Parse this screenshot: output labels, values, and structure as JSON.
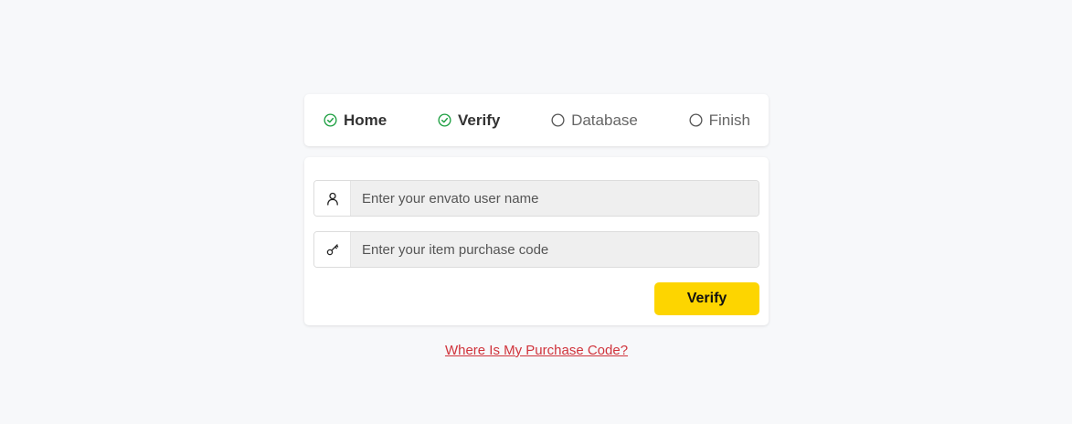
{
  "steps": [
    {
      "label": "Home",
      "status": "done"
    },
    {
      "label": "Verify",
      "status": "done"
    },
    {
      "label": "Database",
      "status": "pending"
    },
    {
      "label": "Finish",
      "status": "pending"
    }
  ],
  "form": {
    "username_placeholder": "Enter your envato user name",
    "username_icon": "user-icon",
    "purchase_code_placeholder": "Enter your item purchase code",
    "purchase_code_icon": "key-icon",
    "verify_label": "Verify"
  },
  "help_link": "Where Is My Purchase Code?",
  "colors": {
    "accent_button": "#fdd500",
    "check_green": "#1a9e3f",
    "link_red": "#d0343c",
    "background": "#f7f8fa"
  }
}
